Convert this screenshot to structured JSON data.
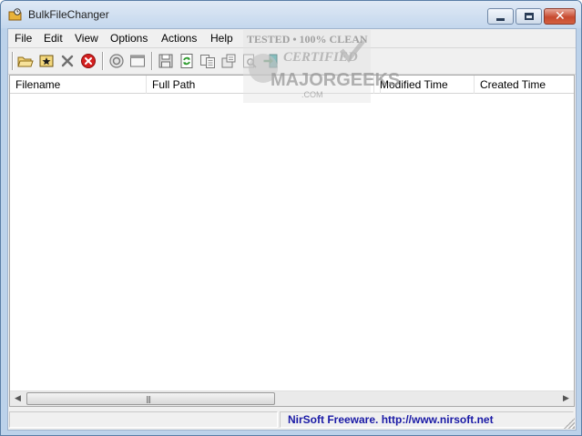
{
  "window": {
    "title": "BulkFileChanger",
    "app_icon": "bulkfilechanger-icon",
    "controls": [
      "minimize-icon",
      "maximize-icon",
      "close-icon"
    ]
  },
  "menu": {
    "items": [
      {
        "label": "File"
      },
      {
        "label": "Edit"
      },
      {
        "label": "View"
      },
      {
        "label": "Options"
      },
      {
        "label": "Actions"
      },
      {
        "label": "Help"
      }
    ]
  },
  "toolbar": {
    "buttons": [
      {
        "icon": "open-folder-icon"
      },
      {
        "icon": "add-files-star-icon"
      },
      {
        "icon": "delete-x-icon"
      },
      {
        "icon": "clear-red-circle-icon"
      },
      {
        "icon": "properties-icon"
      },
      {
        "icon": "window-icon"
      },
      {
        "icon": "save-icon"
      },
      {
        "icon": "refresh-icon"
      },
      {
        "icon": "copy-icon"
      },
      {
        "icon": "change-properties-icon"
      },
      {
        "icon": "find-icon"
      },
      {
        "icon": "exit-icon"
      }
    ]
  },
  "list": {
    "columns": [
      {
        "label": "Filename"
      },
      {
        "label": "Full Path"
      },
      {
        "label": ""
      },
      {
        "label": "Modified Time"
      },
      {
        "label": "Created Time"
      }
    ],
    "rows": []
  },
  "statusbar": {
    "left_text": "",
    "link_text": "NirSoft Freeware.  http://www.nirsoft.net"
  },
  "watermark": {
    "top": "TESTED • 100% CLEAN",
    "middle": "CERTIFIED",
    "main": "MAJORGEEKS",
    "sub": ".COM"
  },
  "colors": {
    "titlebar": "#c4d7ed",
    "link": "#1a1aa6",
    "close_button": "#c74a2f"
  }
}
